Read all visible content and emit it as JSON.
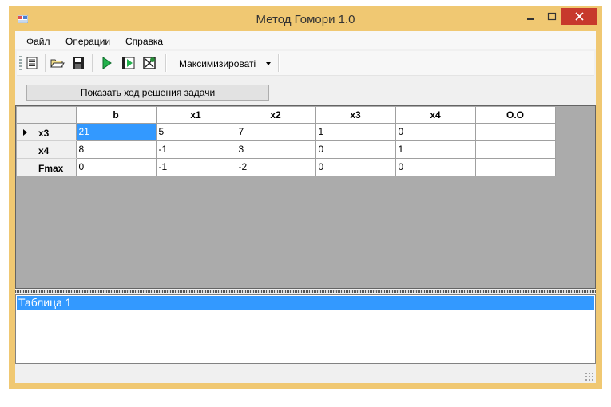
{
  "window": {
    "title": "Метод Гомори 1.0"
  },
  "menu": [
    "Файл",
    "Операции",
    "Справка"
  ],
  "toolbar": {
    "icons": [
      "table-icon",
      "open-folder-icon",
      "save-icon",
      "run-icon",
      "step-forward-icon",
      "stop-icon"
    ],
    "mode_combo": "Максимизироваті"
  },
  "show_solution_button": "Показать ход решения задачи",
  "grid": {
    "columns": [
      "b",
      "x1",
      "x2",
      "x3",
      "x4",
      "O.O"
    ],
    "rows": [
      {
        "header": "x3",
        "cells": [
          "21",
          "5",
          "7",
          "1",
          "0",
          ""
        ]
      },
      {
        "header": "x4",
        "cells": [
          "8",
          "-1",
          "3",
          "0",
          "1",
          ""
        ]
      },
      {
        "header": "Fmax",
        "cells": [
          "0",
          "-1",
          "-2",
          "0",
          "0",
          ""
        ]
      }
    ]
  },
  "list": {
    "items": [
      "Таблица 1"
    ]
  },
  "colors": {
    "frame": "#f0c872",
    "selection": "#3399ff",
    "close": "#c7392c",
    "grid_background": "#ababab"
  }
}
